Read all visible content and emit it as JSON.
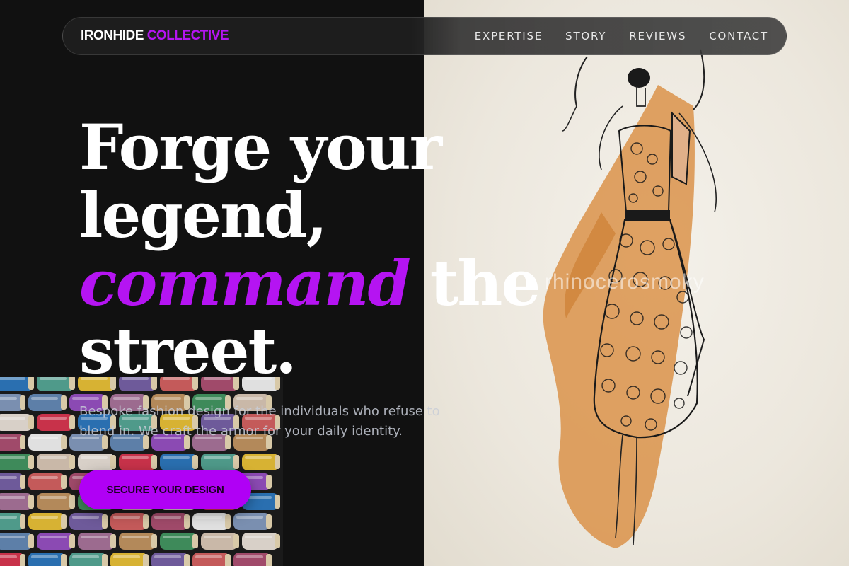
{
  "nav": {
    "brand_primary": "IRONHIDE",
    "brand_accent": "COLLECTIVE",
    "links": [
      "EXPERTISE",
      "STORY",
      "REVIEWS",
      "CONTACT"
    ]
  },
  "hero": {
    "line1": "Forge your",
    "line2": "legend,",
    "line3_accent": "command",
    "line3_rest": "the",
    "line4": "street.",
    "subtext": "Bespoke fashion design for the individuals who refuse to blend in. We craft the armor for your daily identity.",
    "cta_label": "SECURE YOUR DESIGN"
  },
  "art": {
    "watermark": "rhinocerosmoky"
  },
  "colors": {
    "accent": "#b514f2",
    "cta": "#b000f5",
    "background": "#111111",
    "paper": "#ece7dd"
  }
}
